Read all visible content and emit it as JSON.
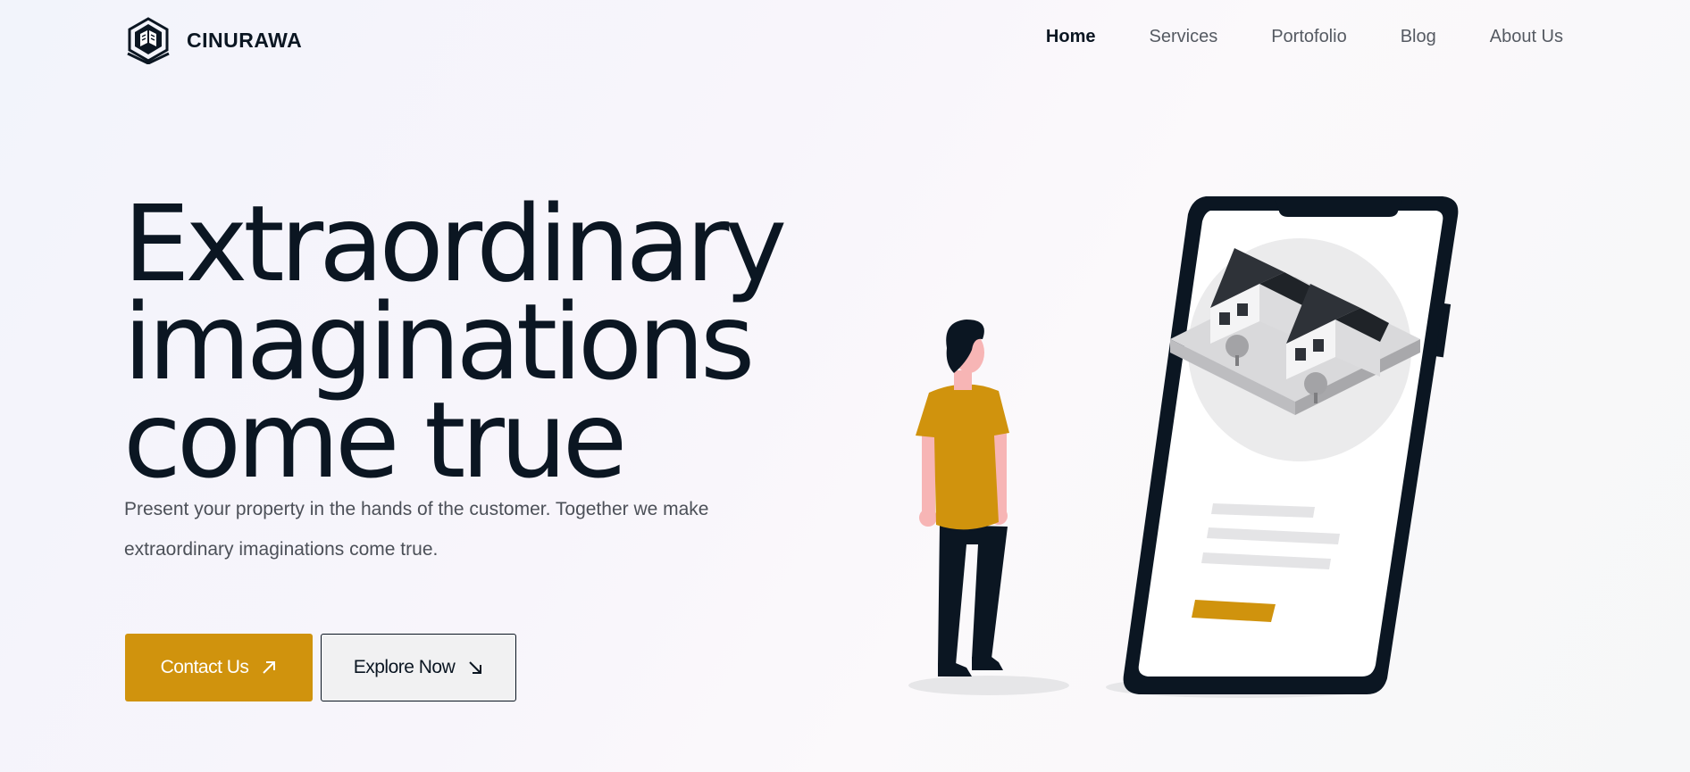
{
  "brand": {
    "name": "CINURAWA",
    "logo_icon": "cinurawa-logo-icon"
  },
  "nav": {
    "items": [
      {
        "label": "Home",
        "active": true
      },
      {
        "label": "Services",
        "active": false
      },
      {
        "label": "Portofolio",
        "active": false
      },
      {
        "label": "Blog",
        "active": false
      },
      {
        "label": "About Us",
        "active": false
      }
    ]
  },
  "hero": {
    "headline_lines": [
      "Extraordinary",
      "imaginations",
      "come true"
    ],
    "subtext": "Present your property in the hands of the customer. Together we make extraordinary imaginations come true.",
    "primary_button": {
      "label": "Contact Us",
      "icon": "arrow-up-right-icon"
    },
    "secondary_button": {
      "label": "Explore Now",
      "icon": "arrow-down-right-icon"
    }
  },
  "colors": {
    "accent": "#d0930d",
    "dark": "#0b1622",
    "muted_text": "#4c5058"
  }
}
